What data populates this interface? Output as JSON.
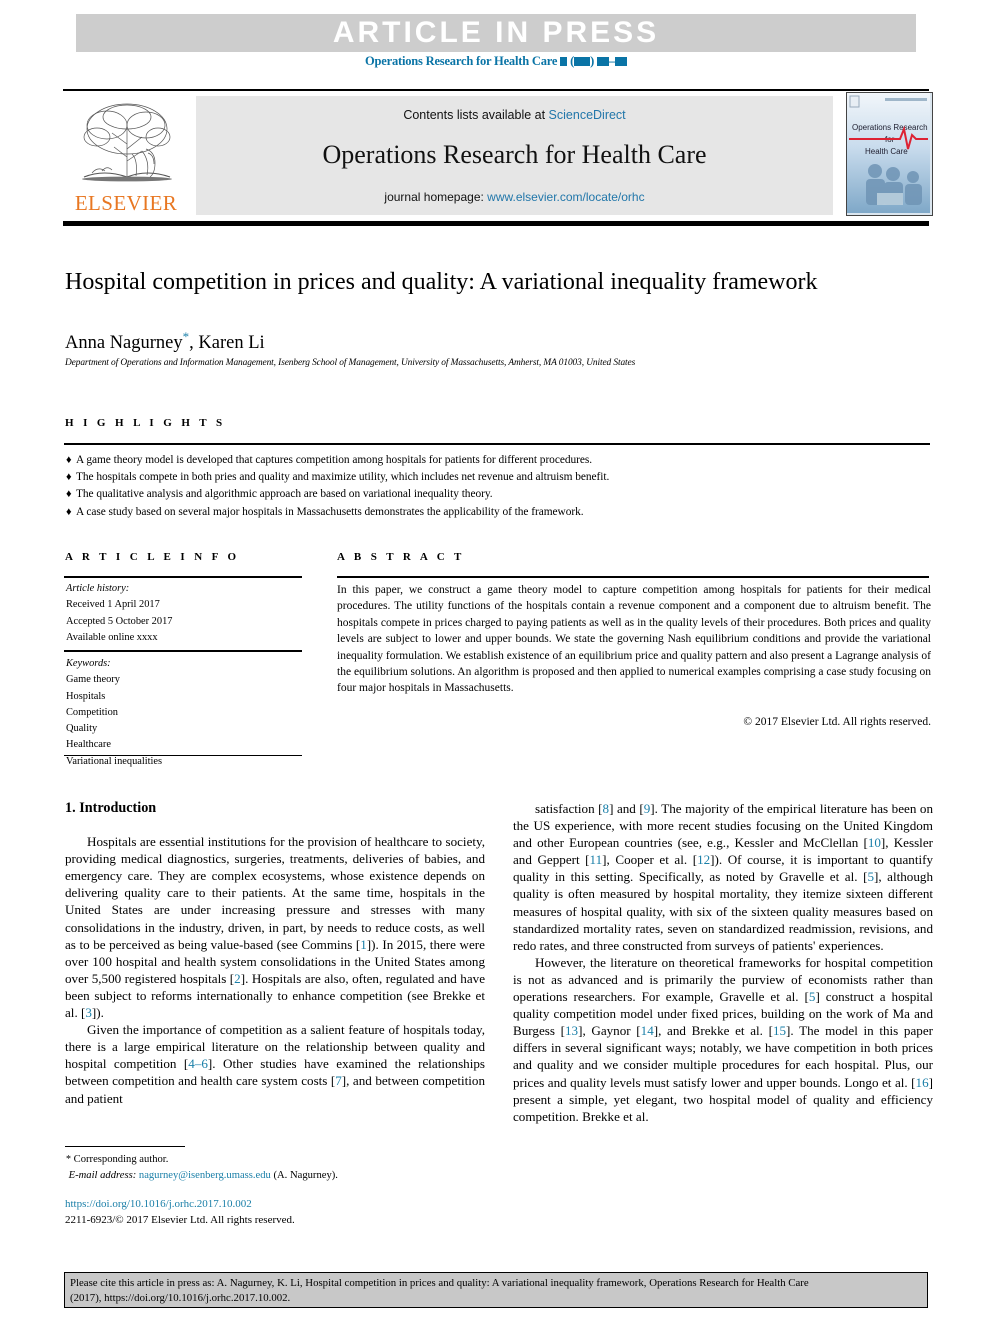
{
  "banner": {
    "text": "ARTICLE IN PRESS",
    "journal_line_prefix": "Operations Research for Health Care",
    "band_color": "#cdcdcd",
    "journal_line_color": "#0a74a6"
  },
  "journal_header": {
    "publisher_name": "ELSEVIER",
    "publisher_color": "#e87722",
    "contents_prefix": "Contents lists available at ",
    "contents_link": "ScienceDirect",
    "journal_title": "Operations Research for Health Care",
    "homepage_prefix": "journal homepage: ",
    "homepage_link": "www.elsevier.com/locate/orhc",
    "cover_title_line1": "Operations Research",
    "cover_title_line2": "for",
    "cover_title_line3": "Health Care",
    "link_color": "#2277aa"
  },
  "article": {
    "title": "Hospital competition in prices and quality: A variational inequality framework",
    "authors_part1": "Anna Nagurney",
    "authors_part2": ", Karen Li",
    "corresponding_marker": "*",
    "affiliation": "Department of Operations and Information Management, Isenberg School of Management, University of Massachusetts, Amherst, MA 01003, United States"
  },
  "highlights": {
    "label": "H I G H L I G H T S",
    "bullet_glyph": "♦",
    "items": [
      "A game theory model is developed that captures competition among hospitals for patients for different procedures.",
      "The hospitals compete in both pries and quality and maximize utility, which includes net revenue and altruism benefit.",
      "The qualitative analysis and algorithmic approach are based on variational inequality theory.",
      "A case study based on several major hospitals in Massachusetts demonstrates the applicability of the framework."
    ]
  },
  "article_info": {
    "label": "A R T I C L E    I N F O",
    "history_heading": "Article history:",
    "history_lines": [
      "Received 1 April 2017",
      "Accepted 5 October 2017",
      "Available online xxxx"
    ],
    "keywords_heading": "Keywords:",
    "keywords": [
      "Game theory",
      "Hospitals",
      "Competition",
      "Quality",
      "Healthcare",
      "Variational inequalities"
    ]
  },
  "abstract": {
    "label": "A B S T R A C T",
    "body": "In this paper, we construct a game theory model to capture competition among hospitals for patients for their medical procedures. The utility functions of the hospitals contain a revenue component and a component due to altruism benefit. The hospitals compete in prices charged to paying patients as well as in the quality levels of their procedures. Both prices and quality levels are subject to lower and upper bounds. We state the governing Nash equilibrium conditions and provide the variational inequality formulation. We establish existence of an equilibrium price and quality pattern and also present a Lagrange analysis of the equilibrium solutions. An algorithm is proposed and then applied to numerical examples comprising a case study focusing on four major hospitals in Massachusetts.",
    "copyright": "© 2017 Elsevier Ltd. All rights reserved."
  },
  "body": {
    "section_heading": "1. Introduction",
    "left_paragraphs": [
      "Hospitals are essential institutions for the provision of healthcare to society, providing medical diagnostics, surgeries, treatments, deliveries of babies, and emergency care. They are complex ecosystems, whose existence depends on delivering quality care to their patients. At the same time, hospitals in the United States are under increasing pressure and stresses with many consolidations in the industry, driven, in part, by needs to reduce costs, as well as to be perceived as being value-based (see Commins [1]). In 2015, there were over 100 hospital and health system consolidations in the United States among over 5,500 registered hospitals [2]. Hospitals are also, often, regulated and have been subject to reforms internationally to enhance competition (see Brekke et al. [3]).",
      "Given the importance of competition as a salient feature of hospitals today, there is a large empirical literature on the relationship between quality and hospital competition [4–6]. Other studies have examined the relationships between competition and health care system costs [7], and between competition and patient"
    ],
    "right_paragraphs": [
      "satisfaction [8] and [9]. The majority of the empirical literature has been on the US experience, with more recent studies focusing on the United Kingdom and other European countries (see, e.g., Kessler and McClellan [10], Kessler and Geppert [11], Cooper et al. [12]). Of course, it is important to quantify quality in this setting. Specifically, as noted by Gravelle et al. [5], although quality is often measured by hospital mortality, they itemize sixteen different measures of hospital quality, with six of the sixteen quality measures based on standardized mortality rates, seven on standardized readmission, revisions, and redo rates, and three constructed from surveys of patients' experiences.",
      "However, the literature on theoretical frameworks for hospital competition is not as advanced and is primarily the purview of economists rather than operations researchers. For example, Gravelle et al. [5] construct a hospital quality competition model under fixed prices, building on the work of Ma and Burgess [13], Gaynor [14], and Brekke et al. [15]. The model in this paper differs in several significant ways; notably, we have competition in both prices and quality and we consider multiple procedures for each hospital. Plus, our prices and quality levels must satisfy lower and upper bounds. Longo et al. [16] present a simple, yet elegant, two hospital model of quality and efficiency competition. Brekke et al."
    ],
    "reference_color": "#1a7fa8"
  },
  "footnote": {
    "marker": "*",
    "corresponding": "Corresponding author.",
    "email_label": "E-mail address:",
    "email": "nagurney@isenberg.umass.edu",
    "email_suffix": " (A. Nagurney)."
  },
  "publication": {
    "doi": "https://doi.org/10.1016/j.orhc.2017.10.002",
    "issn_line": "2211-6923/© 2017 Elsevier Ltd. All rights reserved."
  },
  "cite_footer": {
    "line1": "Please cite this article in press as: A. Nagurney, K. Li, Hospital competition in prices and quality: A variational inequality framework, Operations Research for Health Care",
    "line2": "(2017), https://doi.org/10.1016/j.orhc.2017.10.002.",
    "background": "#c8c8c8"
  }
}
